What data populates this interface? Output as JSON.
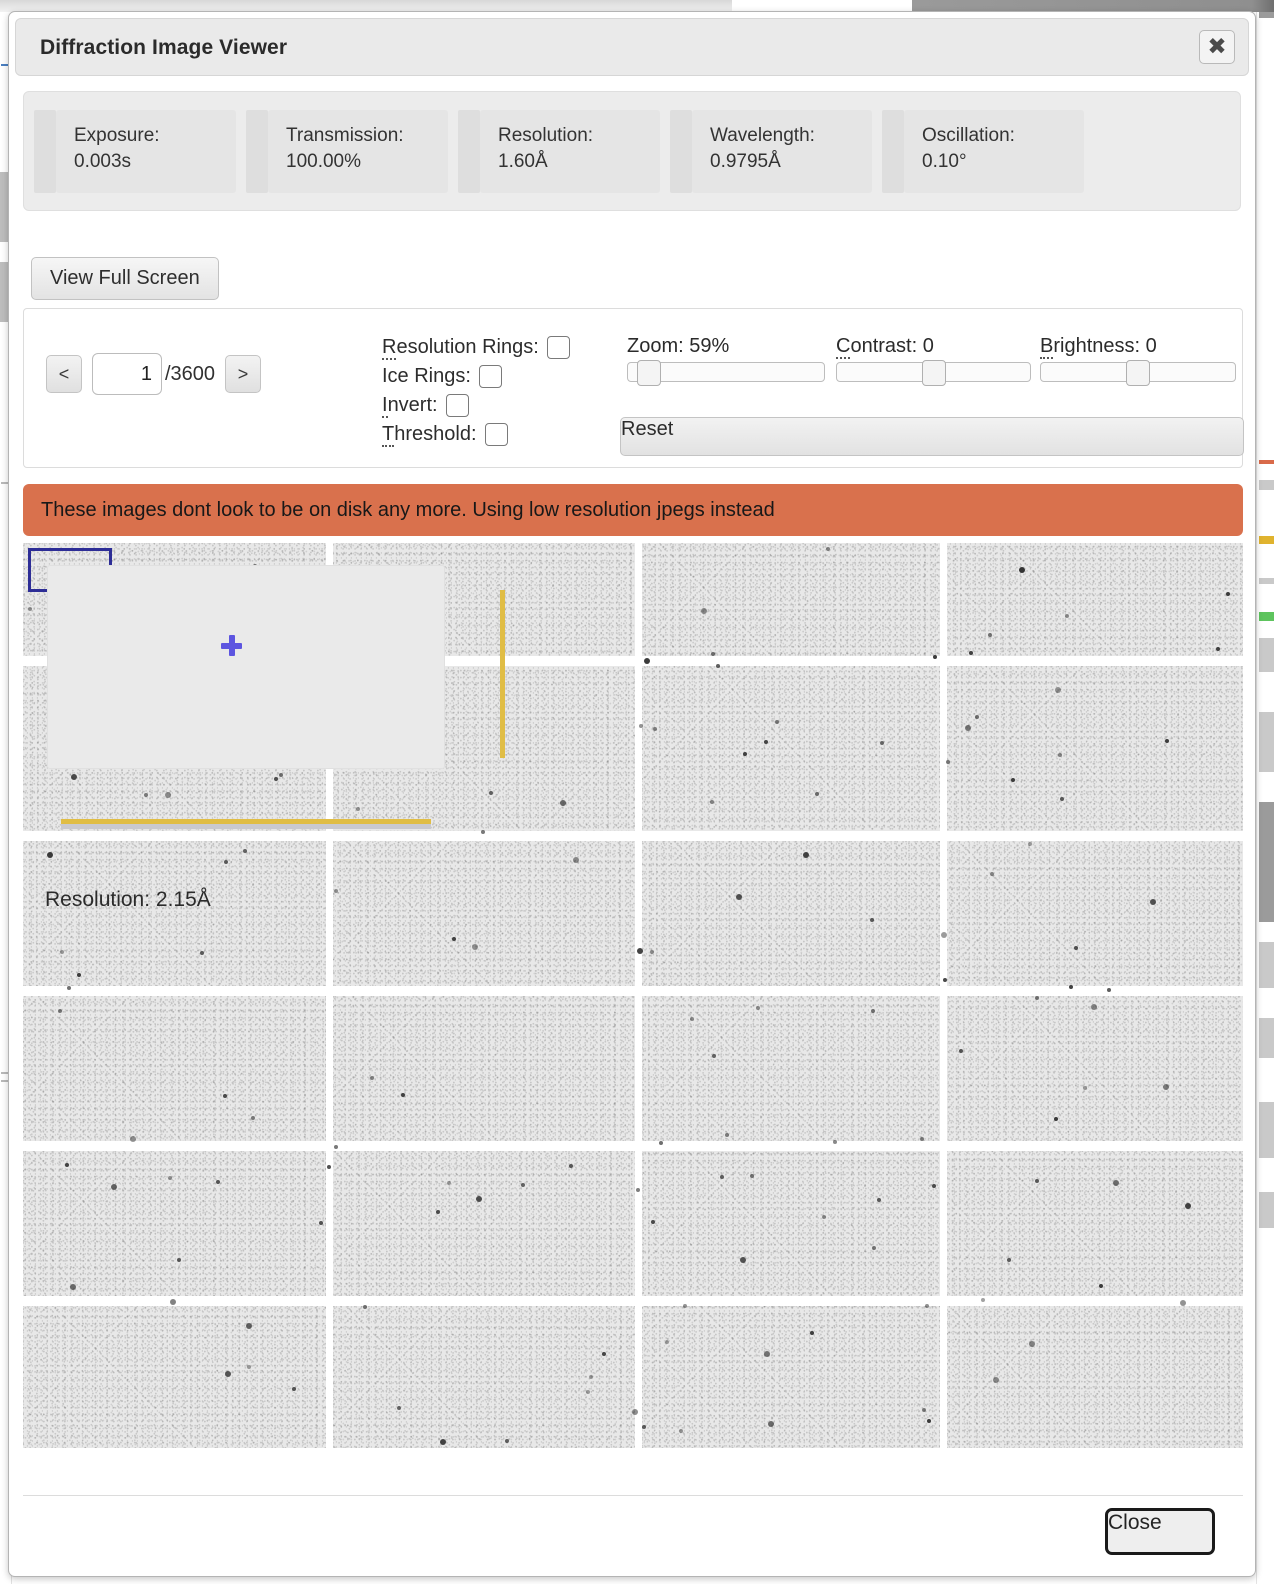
{
  "window": {
    "title": "Diffraction Image Viewer",
    "close_icon": "close-x-icon",
    "close_icon_glyph": "✖"
  },
  "metadata": [
    {
      "label": "Exposure:",
      "value": "0.003s"
    },
    {
      "label": "Transmission:",
      "value": "100.00%"
    },
    {
      "label": "Resolution:",
      "value": "1.60Å"
    },
    {
      "label": "Wavelength:",
      "value": "0.9795Å"
    },
    {
      "label": "Oscillation:",
      "value": "0.10°"
    }
  ],
  "toolbar": {
    "fullscreen_label": "View Full Screen"
  },
  "controls": {
    "nav": {
      "prev_label": "<",
      "next_label": ">",
      "frame_value": "1",
      "frame_total": "/3600"
    },
    "checkboxes": [
      {
        "accesskey": "R",
        "rest": "esolution Rings:",
        "checked": false,
        "name": "resolution-rings"
      },
      {
        "accesskey": "",
        "rest": "Ice Rings:",
        "checked": false,
        "name": "ice-rings"
      },
      {
        "accesskey": "I",
        "rest": "nvert:",
        "checked": false,
        "name": "invert"
      },
      {
        "accesskey": "T",
        "rest": "hreshold:",
        "checked": false,
        "name": "threshold"
      }
    ],
    "sliders": [
      {
        "name": "zoom",
        "label": "Zoom: 59%",
        "accesskey": "",
        "percent": 5
      },
      {
        "name": "contrast",
        "label": "Contrast: 0",
        "accesskey": "C",
        "percent": 50
      },
      {
        "name": "brightness",
        "label": "Brightness: 0",
        "accesskey": "B",
        "percent": 50
      }
    ],
    "reset_label": "Reset"
  },
  "warning": {
    "message": "These images dont look to be on disk any more. Using low resolution jpegs instead",
    "color": "#d9714d"
  },
  "image_overlay": {
    "resolution_text": "Resolution: 2.15Å",
    "crosshair_color": "#5d55e0",
    "ruler_color": "#e0bd45",
    "selection_color": "#2d2d96"
  },
  "footer": {
    "close_label": "Close"
  }
}
